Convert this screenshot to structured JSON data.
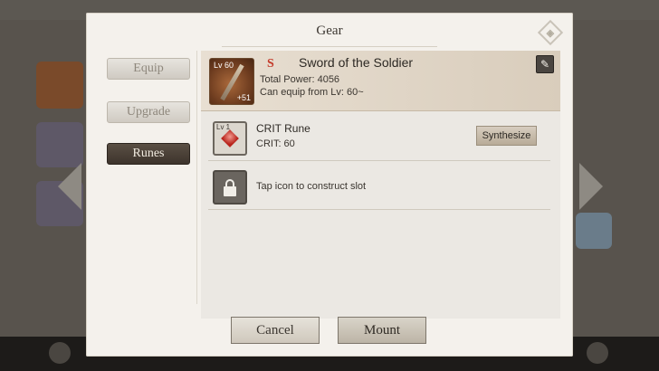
{
  "dialog": {
    "title": "Gear"
  },
  "tabs": [
    {
      "label": "Equip",
      "active": false
    },
    {
      "label": "Upgrade",
      "active": false
    },
    {
      "label": "Runes",
      "active": true
    }
  ],
  "item": {
    "level": "Lv 60",
    "rank": "S",
    "name": "Sword of the Soldier",
    "total_power": "Total Power: 4056",
    "equip_requirement": "Can equip from Lv: 60~",
    "enhance": "+51"
  },
  "runes": [
    {
      "level": "Lv 1",
      "name": "CRIT Rune",
      "stat": "CRIT: 60",
      "action": "Synthesize"
    }
  ],
  "locked_slot": {
    "hint": "Tap icon to construct slot"
  },
  "buttons": {
    "cancel": "Cancel",
    "mount": "Mount"
  },
  "icons": {
    "help": "diamond-help-icon",
    "edit": "sword-edit-icon",
    "lock": "lock-icon",
    "rune": "red-gem-icon"
  },
  "colors": {
    "rank_s": "#c43a2a",
    "active_tab": "#3d342c"
  }
}
